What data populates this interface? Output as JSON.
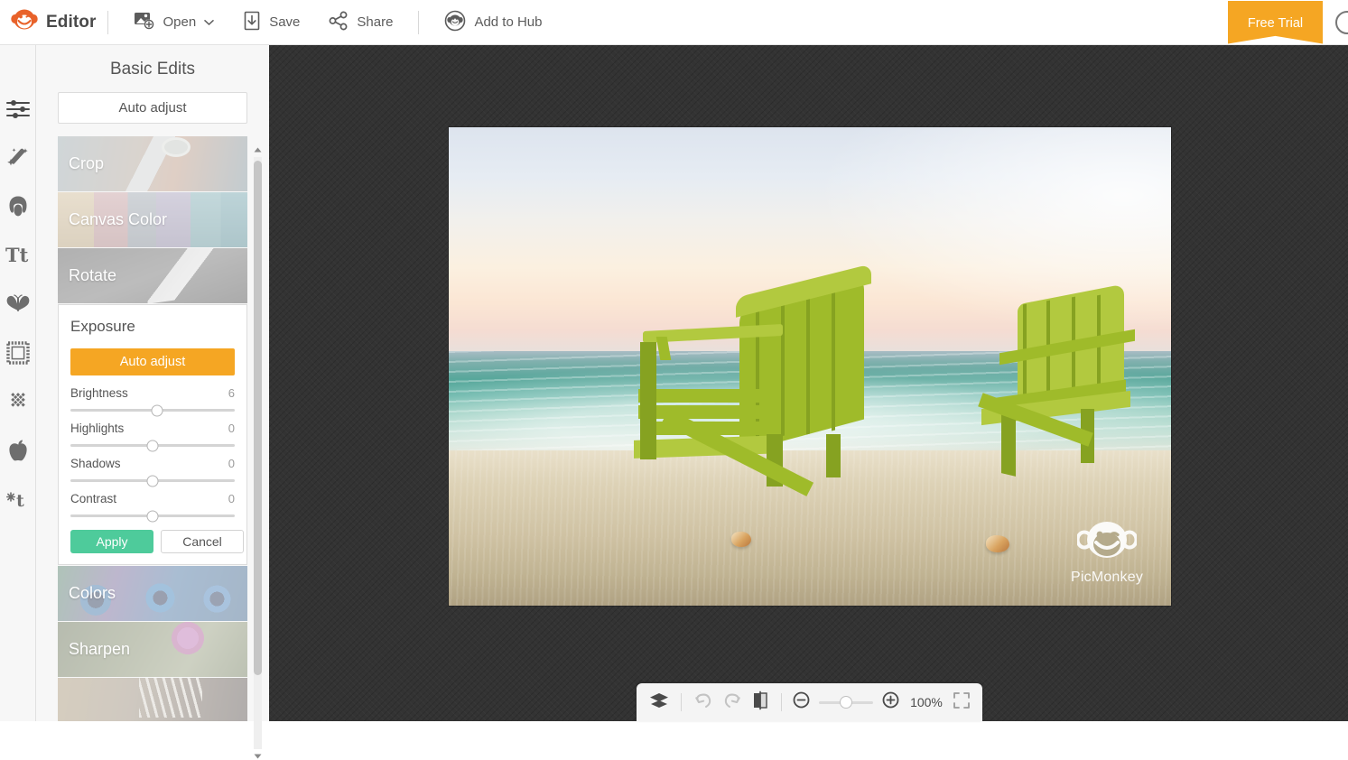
{
  "header": {
    "brand_label": "Editor",
    "brand_icon": "picmonkey-monkey-icon",
    "open_label": "Open",
    "open_icon": "add-photo-icon",
    "open_caret": "chevron-down-icon",
    "save_label": "Save",
    "save_icon": "download-icon",
    "share_label": "Share",
    "share_icon": "share-nodes-icon",
    "hub_label": "Add to Hub",
    "hub_icon": "hub-monkey-icon",
    "free_trial_label": "Free Trial",
    "free_trial_color": "#f5a623",
    "account_icon": "account-circle-icon"
  },
  "rail": {
    "items": [
      {
        "icon": "sliders-icon",
        "name": "basic-edits",
        "active": true
      },
      {
        "icon": "magic-wand-icon",
        "name": "effects",
        "active": false
      },
      {
        "icon": "face-touchup-icon",
        "name": "touch-up",
        "active": false
      },
      {
        "icon": "text-tt-icon",
        "name": "text",
        "active": false
      },
      {
        "icon": "butterfly-icon",
        "name": "overlays",
        "active": false
      },
      {
        "icon": "frame-icon",
        "name": "frames",
        "active": false
      },
      {
        "icon": "texture-icon",
        "name": "textures",
        "active": false
      },
      {
        "icon": "apple-icon",
        "name": "themes",
        "active": false
      },
      {
        "icon": "snowflake-t-icon",
        "name": "seasonal",
        "active": false
      }
    ]
  },
  "panel": {
    "title": "Basic Edits",
    "auto_adjust_label": "Auto adjust",
    "tiles_top": [
      {
        "label": "Crop",
        "bg": "bg-crop"
      },
      {
        "label": "Canvas Color",
        "bg": "bg-canvas"
      },
      {
        "label": "Rotate",
        "bg": "bg-rotate"
      }
    ],
    "tiles_bottom": [
      {
        "label": "Colors",
        "bg": "bg-colors"
      },
      {
        "label": "Sharpen",
        "bg": "bg-sharpen"
      },
      {
        "label": "",
        "bg": "bg-last"
      }
    ],
    "exposure": {
      "title": "Exposure",
      "auto_adjust_label": "Auto adjust",
      "auto_adjust_color": "#f5a623",
      "sliders": [
        {
          "name": "Brightness",
          "value": "6",
          "pct": 53
        },
        {
          "name": "Highlights",
          "value": "0",
          "pct": 50
        },
        {
          "name": "Shadows",
          "value": "0",
          "pct": 50
        },
        {
          "name": "Contrast",
          "value": "0",
          "pct": 50
        }
      ],
      "apply_label": "Apply",
      "apply_color": "#4ecb9b",
      "cancel_label": "Cancel"
    },
    "scrollbar": {
      "up_icon": "scroll-up-arrow-icon",
      "down_icon": "scroll-down-arrow-icon"
    }
  },
  "canvas": {
    "background_color": "#333333",
    "photo": {
      "alt": "beach-photo-with-two-green-adirondack-chairs",
      "watermark_text": "PicMonkey",
      "watermark_icon": "picmonkey-monkey-watermark-icon"
    }
  },
  "bottombar": {
    "layers_icon": "layers-icon",
    "undo_icon": "undo-arrow-icon",
    "redo_icon": "redo-arrow-icon",
    "compare_icon": "compare-split-icon",
    "zoom_out_icon": "zoom-out-minus-icon",
    "zoom_in_icon": "zoom-in-plus-icon",
    "zoom_percent": "100%",
    "zoom_slider_pct": 50,
    "fit_screen_icon": "fit-to-screen-icon"
  }
}
